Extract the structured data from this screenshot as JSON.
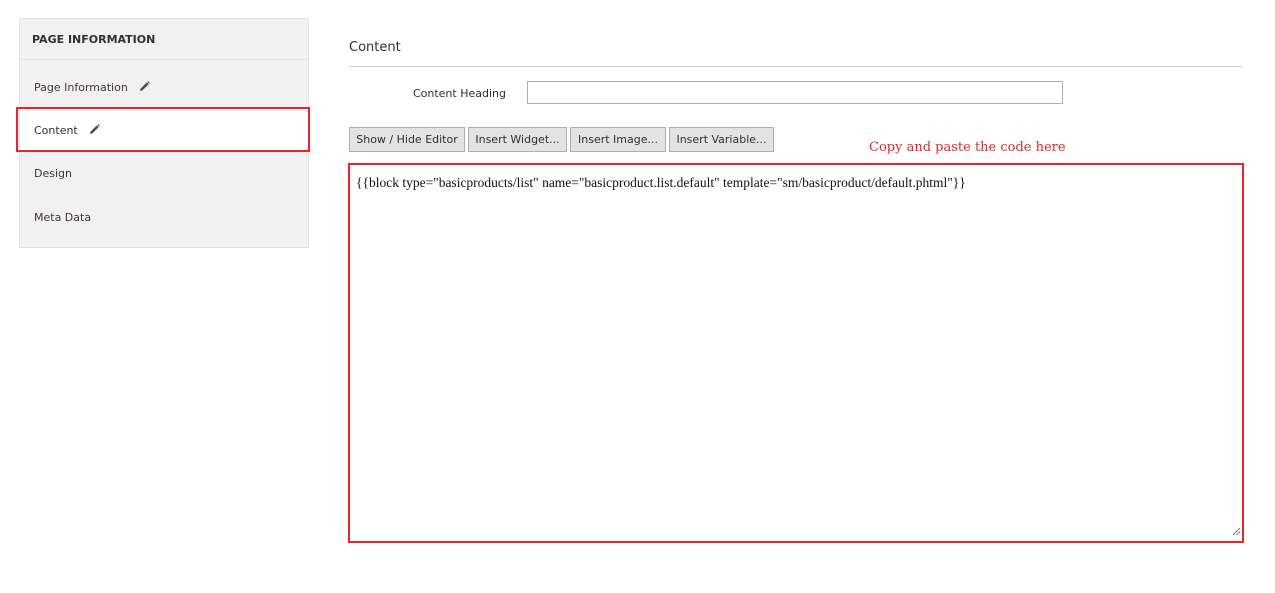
{
  "sidebar": {
    "title": "PAGE INFORMATION",
    "items": [
      {
        "label": "Page Information",
        "has_edit_icon": true,
        "active": false
      },
      {
        "label": "Content",
        "has_edit_icon": true,
        "active": true
      },
      {
        "label": "Design",
        "has_edit_icon": false,
        "active": false
      },
      {
        "label": "Meta Data",
        "has_edit_icon": false,
        "active": false
      }
    ]
  },
  "content": {
    "section_title": "Content",
    "heading_field": {
      "label": "Content Heading",
      "value": ""
    },
    "toolbar": {
      "show_hide_label": "Show / Hide Editor",
      "insert_widget_label": "Insert Widget...",
      "insert_image_label": "Insert Image...",
      "insert_variable_label": "Insert Variable..."
    },
    "annotation": "Copy and paste the code here",
    "editor_value": "{{block type=\"basicproducts/list\" name=\"basicproduct.list.default\" template=\"sm/basicproduct/default.phtml\"}}"
  },
  "icons": {
    "edit": "pencil-icon",
    "resize": "resize-grip-icon"
  },
  "colors": {
    "highlight": "#e8252a",
    "sidebar_bg": "#f1f1f1",
    "button_bg": "#e3e3e3"
  }
}
